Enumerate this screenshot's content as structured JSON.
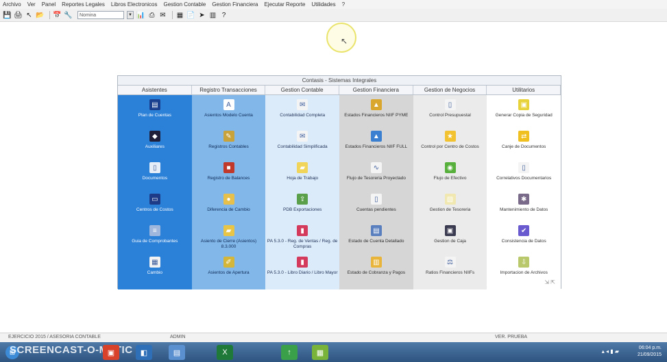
{
  "menu": [
    "Archivo",
    "Ver",
    "Panel",
    "Reportes Legales",
    "Libros Electronicos",
    "Gestion Contable",
    "Gestion Financiera",
    "Ejecutar Reporte",
    "Utilidades",
    "?"
  ],
  "toolbar": {
    "icons": [
      "disk-icon",
      "printer-icon",
      "cursor-icon",
      "folder-icon",
      "calendar-icon",
      "tree-icon"
    ],
    "combo_value": "Nomina",
    "icons2": [
      "chart-icon",
      "print-icon",
      "mail-icon",
      "grid-icon",
      "doc-icon",
      "arrow-icon",
      "chart-bar-icon",
      "help-icon"
    ]
  },
  "panel": {
    "title": "Contasis - Sistemas Integrales",
    "headers": [
      "Asistentes",
      "Registro Transacciones",
      "Gestion Contable",
      "Gestion Financiera",
      "Gestion de Negocios",
      "Utilitarios"
    ],
    "columns": [
      {
        "items": [
          {
            "label": "Plan de Cuentas",
            "icon": "table-icon",
            "color": "#1a3f8e"
          },
          {
            "label": "Auxiliares",
            "icon": "person-icon",
            "color": "#1f1f3a"
          },
          {
            "label": "Documentos",
            "icon": "document-icon",
            "color": "#e8eef8"
          },
          {
            "label": "Centros de Costos",
            "icon": "monitor-icon",
            "color": "#1e3b88"
          },
          {
            "label": "Guia de Comprobantes",
            "icon": "list-icon",
            "color": "#9fb7dd"
          },
          {
            "label": "Cambio",
            "icon": "calculator-icon",
            "color": "#f2f2f2"
          }
        ]
      },
      {
        "items": [
          {
            "label": "Asientos Modelo Cuenta",
            "icon": "letter-a-icon",
            "color": "#ffffff"
          },
          {
            "label": "Registros Contables",
            "icon": "edit-icon",
            "color": "#c8a23a"
          },
          {
            "label": "Registro de Balances",
            "icon": "cubes-icon",
            "color": "#c0392b"
          },
          {
            "label": "Diferencia de Cambio",
            "icon": "coin-icon",
            "color": "#e6c04a"
          },
          {
            "label": "Asiento de Cierre (Asientos) 8.3.000",
            "icon": "folder-icon",
            "color": "#e8c547"
          },
          {
            "label": "Asientos de Apertura",
            "icon": "pen-icon",
            "color": "#d4b63a"
          }
        ]
      },
      {
        "items": [
          {
            "label": "Contabilidad Completa",
            "icon": "envelope-icon",
            "color": "#f4f4f4"
          },
          {
            "label": "Contabilidad Simplificada",
            "icon": "envelope-icon",
            "color": "#f4f4f4"
          },
          {
            "label": "Hoja de Trabajo",
            "icon": "folder-icon",
            "color": "#f0d55a"
          },
          {
            "label": "PDB Exportaciones",
            "icon": "export-icon",
            "color": "#5aa04a"
          },
          {
            "label": "PA 5.3.0 - Reg. de Ventas / Reg. de Compras",
            "icon": "book-icon",
            "color": "#d43a5c"
          },
          {
            "label": "PA 5.3.0 - Libro Diario / Libro Mayor",
            "icon": "book-icon",
            "color": "#d43a5c"
          }
        ]
      },
      {
        "items": [
          {
            "label": "Estados Financieros NIIF PYME",
            "icon": "chart-icon",
            "color": "#d9a62e"
          },
          {
            "label": "Estados Financieros NIIF FULL",
            "icon": "chart-icon",
            "color": "#3a7fd0"
          },
          {
            "label": "Flujo de Tesoreria Proyectado",
            "icon": "graph-icon",
            "color": "#f4f4f4"
          },
          {
            "label": "Cuentas pendientes",
            "icon": "doc-icon",
            "color": "#f4f4f4"
          },
          {
            "label": "Estado de Cuenta Detallado",
            "icon": "report-icon",
            "color": "#5a7fbf"
          },
          {
            "label": "Estado de Cobranza y Pagos",
            "icon": "clipboard-icon",
            "color": "#e8b53a"
          }
        ]
      },
      {
        "items": [
          {
            "label": "Control Presupuestal",
            "icon": "doc-icon",
            "color": "#f4f4f4"
          },
          {
            "label": "Control por Centro de Costos",
            "icon": "star-icon",
            "color": "#f2c230"
          },
          {
            "label": "Flujo de Efectivo",
            "icon": "gauge-icon",
            "color": "#58b03c"
          },
          {
            "label": "Gestion de Tesoreria",
            "icon": "notepad-icon",
            "color": "#f0e8b0"
          },
          {
            "label": "Gestion de Caja",
            "icon": "register-icon",
            "color": "#3a3a50"
          },
          {
            "label": "Ratios Financieros NIIFs",
            "icon": "scale-icon",
            "color": "#f4f4f4"
          }
        ]
      },
      {
        "items": [
          {
            "label": "Generar Copia de Seguridad",
            "icon": "backup-icon",
            "color": "#e8d23a"
          },
          {
            "label": "Canje de Documentos",
            "icon": "swap-icon",
            "color": "#f0c020"
          },
          {
            "label": "Correlativos Documentarios",
            "icon": "docs-icon",
            "color": "#f4f4f4"
          },
          {
            "label": "Mantenimiento de Datos",
            "icon": "tools-icon",
            "color": "#7a6a8a"
          },
          {
            "label": "Consistencia de Datos",
            "icon": "check-icon",
            "color": "#6a5acf"
          },
          {
            "label": "Importacion de Archivos",
            "icon": "import-icon",
            "color": "#b8c86a"
          }
        ]
      }
    ]
  },
  "status": {
    "left": "EJERCICIO 2015 / ASESORIA CONTABLE",
    "middle": "ADMIN",
    "right": "VER. PRUEBA"
  },
  "taskbar": {
    "watermark": "SCREENCAST-O-MATIC",
    "time": "06:04 p.m.",
    "date": "21/09/2015"
  }
}
